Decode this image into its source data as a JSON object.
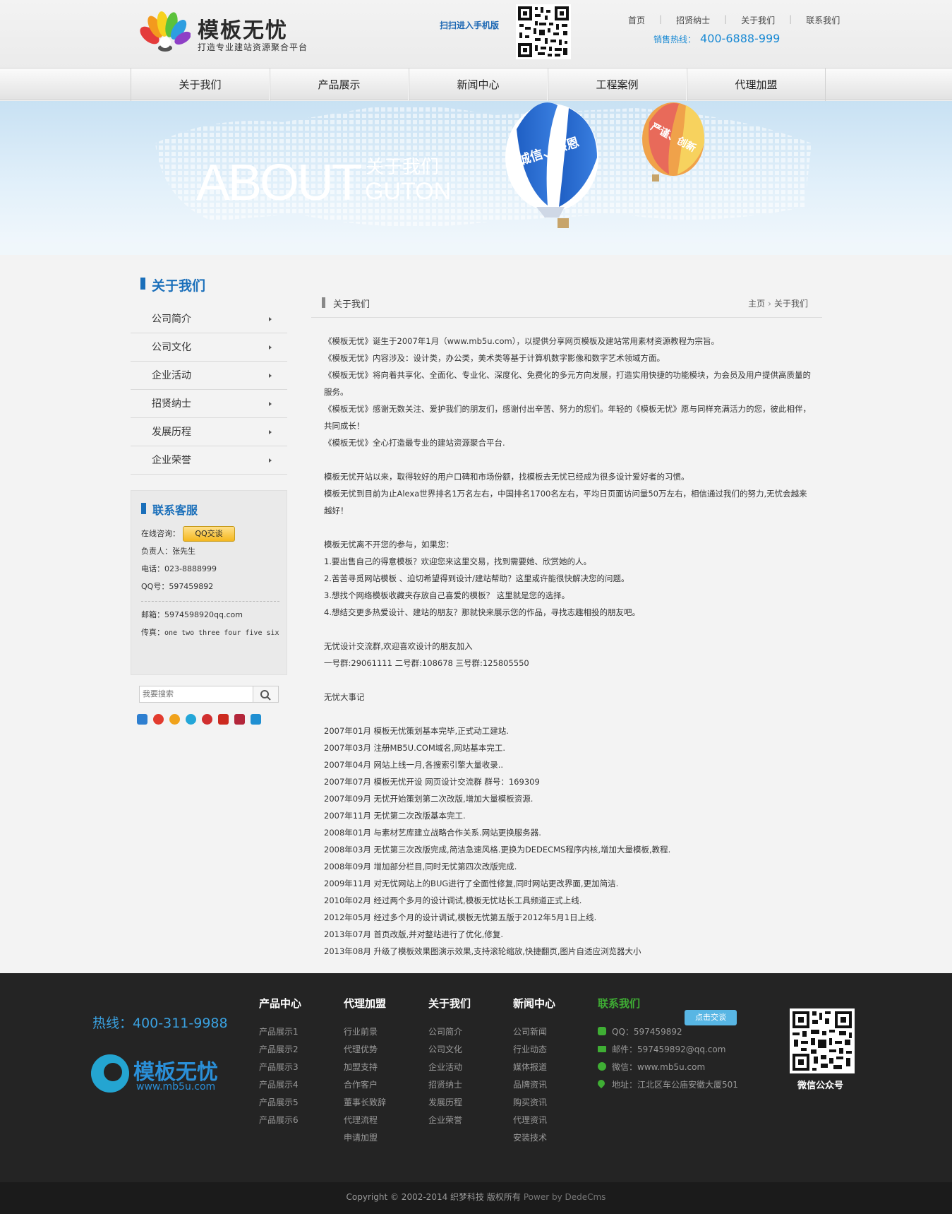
{
  "header": {
    "brand_name": "模板无忧",
    "slogan": "打造专业建站资源聚合平台",
    "mobile_label": "扫扫进入手机版",
    "top_links": [
      "首页",
      "招贤纳士",
      "关于我们",
      "联系我们"
    ],
    "hotline_label": "销售热线：",
    "hotline_number": "400-6888-999"
  },
  "nav": {
    "items": [
      "关于我们",
      "产品展示",
      "新闻中心",
      "工程案例",
      "代理加盟"
    ]
  },
  "banner": {
    "title_en": "ABOUT",
    "title_cn": "关于我们",
    "title_sub": "GUTON",
    "balloon_big": "诚信、感恩",
    "balloon_small": "严谨、创新"
  },
  "sidebar": {
    "title": "关于我们",
    "items": [
      "公司简介",
      "公司文化",
      "企业活动",
      "招贤纳士",
      "发展历程",
      "企业荣誉"
    ],
    "contact": {
      "title": "联系客服",
      "online_label": "在线咨询：",
      "qq_button": "QQ交谈",
      "person": "负责人：张先生",
      "phone": "电话：023-8888999",
      "qq": "QQ号：597459892",
      "email": "邮箱：5974598920qq.com",
      "fax_label": "传真：",
      "fax_value": "one two three four five six"
    },
    "search_placeholder": "我要搜索",
    "share_colors": [
      "#2e7fd0",
      "#e23b2e",
      "#f0a21b",
      "#23a6d8",
      "#d12f2f",
      "#cc2a1f",
      "#b3263a",
      "#1f8fd2"
    ]
  },
  "main": {
    "heading": "关于我们",
    "breadcrumb": [
      "主页",
      "关于我们"
    ],
    "paragraphs": [
      "《模板无忧》诞生于2007年1月（www.mb5u.com），以提供分享网页模板及建站常用素材资源教程为宗旨。",
      "《模板无忧》内容涉及：设计类，办公类，美术类等基于计算机数字影像和数字艺术领域方面。",
      "《模板无忧》将向着共享化、全面化、专业化、深度化、免费化的多元方向发展，打造实用快捷的功能模块，为会员及用户提供高质量的服务。",
      "《模板无忧》感谢无数关注、爱护我们的朋友们，感谢付出辛苦、努力的您们。年轻的《模板无忧》愿与同样充满活力的您，彼此相伴，共同成长！",
      "《模板无忧》全心打造最专业的建站资源聚合平台.",
      "",
      "模板无忧开站以来，取得较好的用户口碑和市场份额，找模板去无忧已经成为很多设计爱好者的习惯。",
      "模板无忧到目前为止Alexa世界排名1万名左右，中国排名1700名左右，平均日页面访问量50万左右，相信通过我们的努力,无忧会越来越好！",
      "",
      "模板无忧离不开您的参与，如果您：",
      "1.要出售自己的得意模板？欢迎您来这里交易，找到需要她、欣赏她的人。",
      "2.苦苦寻觅网站模板 、迫切希望得到设计/建站帮助？这里或许能很快解决您的问题。",
      "3.想找个网络模板收藏夹存放自己喜爱的模板？ 这里就是您的选择。",
      "4.想结交更多热爱设计、建站的朋友？那就快来展示您的作品，寻找志趣相投的朋友吧。",
      "",
      "无忧设计交流群,欢迎喜欢设计的朋友加入",
      "一号群:29061111 二号群:108678 三号群:125805550",
      "",
      "无忧大事记",
      "",
      "2007年01月 模板无忧策划基本完毕,正式动工建站.",
      "2007年03月 注册MB5U.COM域名,网站基本完工.",
      "2007年04月 网站上线一月,各搜索引擎大量收录..",
      "2007年07月 模板无忧开设 网页设计交流群 群号：169309",
      "2007年09月 无忧开始策划第二次改版,增加大量模板资源.",
      "2007年11月 无忧第二次改版基本完工.",
      "2008年01月 与素材艺库建立战略合作关系.网站更换服务器.",
      "2008年03月 无忧第三次改版完成,简洁急速风格.更换为DEDECMS程序内核,增加大量模板,教程.",
      "2008年09月 增加部分栏目,同时无忧第四次改版完成.",
      "2009年11月 对无忧网站上的BUG进行了全面性修复,同时网站更改界面,更加简洁.",
      "2010年02月 经过两个多月的设计调试,模板无忧站长工具频道正式上线.",
      "2012年05月 经过多个月的设计调试,模板无忧第五版于2012年5月1日上线.",
      "2013年07月 首页改版,并对整站进行了优化,修复.",
      "2013年08月 升级了模板效果图演示效果,支持滚轮缩放,快捷翻页,图片自适应浏览器大小"
    ]
  },
  "footer": {
    "hotline": "热线：400-311-9988",
    "logo_text": "模板无忧",
    "logo_url": "www.mb5u.com",
    "columns": [
      {
        "title": "产品中心",
        "items": [
          "产品展示1",
          "产品展示2",
          "产品展示3",
          "产品展示4",
          "产品展示5",
          "产品展示6"
        ]
      },
      {
        "title": "代理加盟",
        "items": [
          "行业前景",
          "代理优势",
          "加盟支持",
          "合作客户",
          "董事长致辞",
          "代理流程",
          "申请加盟"
        ]
      },
      {
        "title": "关于我们",
        "items": [
          "公司简介",
          "公司文化",
          "企业活动",
          "招贤纳士",
          "发展历程",
          "企业荣誉"
        ]
      },
      {
        "title": "新闻中心",
        "items": [
          "公司新闻",
          "行业动态",
          "媒体报道",
          "品牌资讯",
          "购买资讯",
          "代理资讯",
          "安装技术"
        ]
      }
    ],
    "contact": {
      "title": "联系我们",
      "talk_button": "点击交谈",
      "qq": "QQ：597459892",
      "email": "邮件：597459892@qq.com",
      "wechat": "微信：www.mb5u.com",
      "address": "地址：江北区车公庙安徽大厦501"
    },
    "qr_label": "微信公众号",
    "copyright": "Copyright © 2002-2014 织梦科技 版权所有",
    "powered": "Power by DedeCms"
  }
}
